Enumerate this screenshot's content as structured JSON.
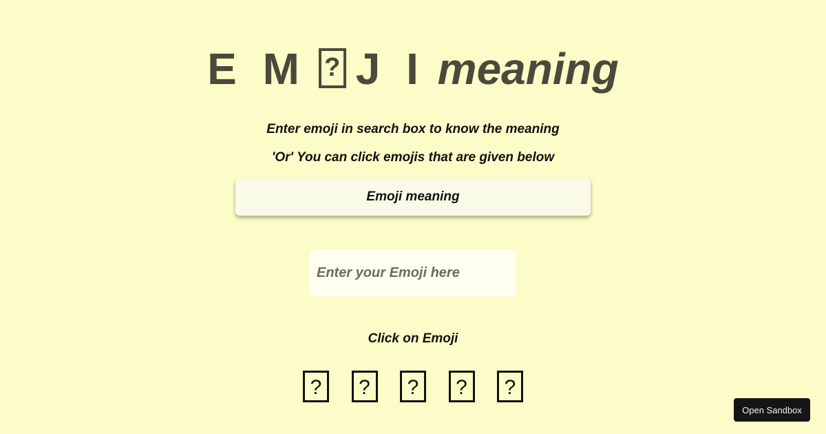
{
  "header": {
    "title_letters_1": "E M",
    "title_letters_2": "J I",
    "title_word": "meaning"
  },
  "instructions": {
    "line1": "Enter emoji in search box to know the meaning",
    "line2": "'Or' You can click emojis that are given below"
  },
  "meaning_output": {
    "text": "Emoji meaning"
  },
  "search": {
    "placeholder": "Enter your Emoji here",
    "value": ""
  },
  "emoji_list": {
    "label": "Click on Emoji",
    "items": [
      {
        "icon": "missing-glyph-icon",
        "glyph": "?"
      },
      {
        "icon": "missing-glyph-icon",
        "glyph": "?"
      },
      {
        "icon": "missing-glyph-icon",
        "glyph": "?"
      },
      {
        "icon": "missing-glyph-icon",
        "glyph": "?"
      },
      {
        "icon": "missing-glyph-icon",
        "glyph": "?"
      }
    ]
  },
  "sandbox": {
    "label": "Open Sandbox"
  },
  "colors": {
    "background": "#fbfcc7",
    "title": "#4a4a3c",
    "meaning_box": "#f9fbe8",
    "input_bg": "#fefff0",
    "sandbox_button": "#151515"
  }
}
